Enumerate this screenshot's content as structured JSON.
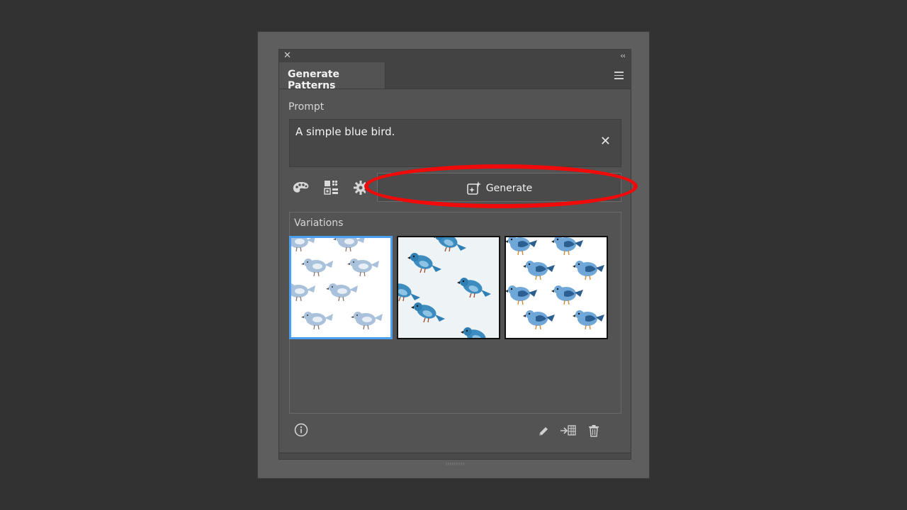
{
  "panel": {
    "title": "Generate Patterns",
    "prompt_label": "Prompt",
    "prompt_value": "A simple blue bird.",
    "generate_label": "Generate",
    "variations_label": "Variations"
  },
  "icons": {
    "close": "close-icon",
    "collapse": "collapse-chevrons-icon",
    "menu": "hamburger-menu-icon",
    "color": "palette-icon",
    "pattern": "pattern-grid-icon",
    "settings": "gear-icon",
    "info": "info-icon",
    "edit": "pencil-icon",
    "apply": "apply-to-swatch-icon",
    "delete": "trash-icon"
  },
  "variations": [
    {
      "style": "pale-blue-birds",
      "selected": true
    },
    {
      "style": "dark-blue-birds-diagonal",
      "selected": false
    },
    {
      "style": "bright-blue-birds",
      "selected": false
    }
  ],
  "colors": {
    "highlight": "#f00a0a",
    "selection": "#4c9ef0"
  }
}
